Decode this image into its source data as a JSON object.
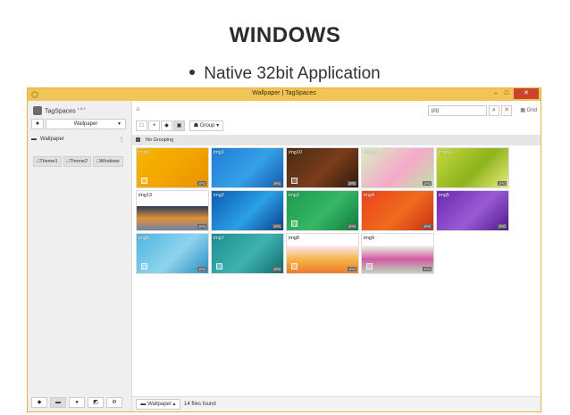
{
  "slide": {
    "title": "WINDOWS",
    "bullet": "Native 32bit Application"
  },
  "window": {
    "title": "Wallpaper | TagSpaces",
    "controls": {
      "minimize": "–",
      "maximize": "□",
      "close": "✕"
    }
  },
  "sidebar": {
    "app_name": "TagSpaces",
    "version": "1.8.4",
    "location_select": "Wallpaper",
    "root_folder": "Wallpaper",
    "subfolders": [
      "Theme1",
      "Theme2",
      "Windows"
    ],
    "bottom_buttons": [
      "tags-icon",
      "folder-icon",
      "chat-icon",
      "export-icon",
      "settings-icon"
    ]
  },
  "main": {
    "search_value": "jpg",
    "view_label": "Grid",
    "group_label": "Group",
    "grouping_label": "No Grouping",
    "files": [
      {
        "name": "img0",
        "colors": [
          "#f7b500",
          "#f2a400",
          "#e99100"
        ],
        "check_visible": true
      },
      {
        "name": "img1",
        "colors": [
          "#1f7bd3",
          "#35a0e8",
          "#155bb0"
        ],
        "check_visible": false
      },
      {
        "name": "img10",
        "colors": [
          "#4a2b14",
          "#7a3d1a",
          "#2f1a0c"
        ],
        "check_visible": true
      },
      {
        "name": "img11",
        "colors": [
          "#d7efc2",
          "#f5a9c9",
          "#bfe2a4"
        ],
        "check_visible": false
      },
      {
        "name": "img12",
        "colors": [
          "#c6d93d",
          "#8db31d",
          "#e6ec7a"
        ],
        "check_visible": false
      },
      {
        "name": "img13",
        "colors": [
          "#2b3c5c",
          "#e3903a",
          "#6a84a6"
        ],
        "check_visible": false
      },
      {
        "name": "img2",
        "colors": [
          "#0d5bb5",
          "#2aa0e6",
          "#0a3f8a"
        ],
        "check_visible": false
      },
      {
        "name": "img3",
        "colors": [
          "#1e9a4e",
          "#36b765",
          "#0f7a3a"
        ],
        "check_visible": true
      },
      {
        "name": "img4",
        "colors": [
          "#e8431b",
          "#f06b1e",
          "#c92e14"
        ],
        "check_visible": false
      },
      {
        "name": "img5",
        "colors": [
          "#6a2ab0",
          "#9b5ad4",
          "#4f1a8a"
        ],
        "check_visible": false
      },
      {
        "name": "img6",
        "colors": [
          "#4db6e0",
          "#8fd3ef",
          "#2a8fc2"
        ],
        "check_visible": true
      },
      {
        "name": "img7",
        "colors": [
          "#1b8f90",
          "#3fb2b0",
          "#0f6b6c"
        ],
        "check_visible": true
      },
      {
        "name": "img8",
        "colors": [
          "#fbe7ef",
          "#f6b44a",
          "#ec7b2a"
        ],
        "check_visible": true
      },
      {
        "name": "img9",
        "colors": [
          "#e9f2e8",
          "#d35aa3",
          "#bcd7bd"
        ],
        "check_visible": true
      }
    ],
    "file_ext": "JPG"
  },
  "statusbar": {
    "location": "Wallpaper",
    "found_text": "14 files found"
  }
}
